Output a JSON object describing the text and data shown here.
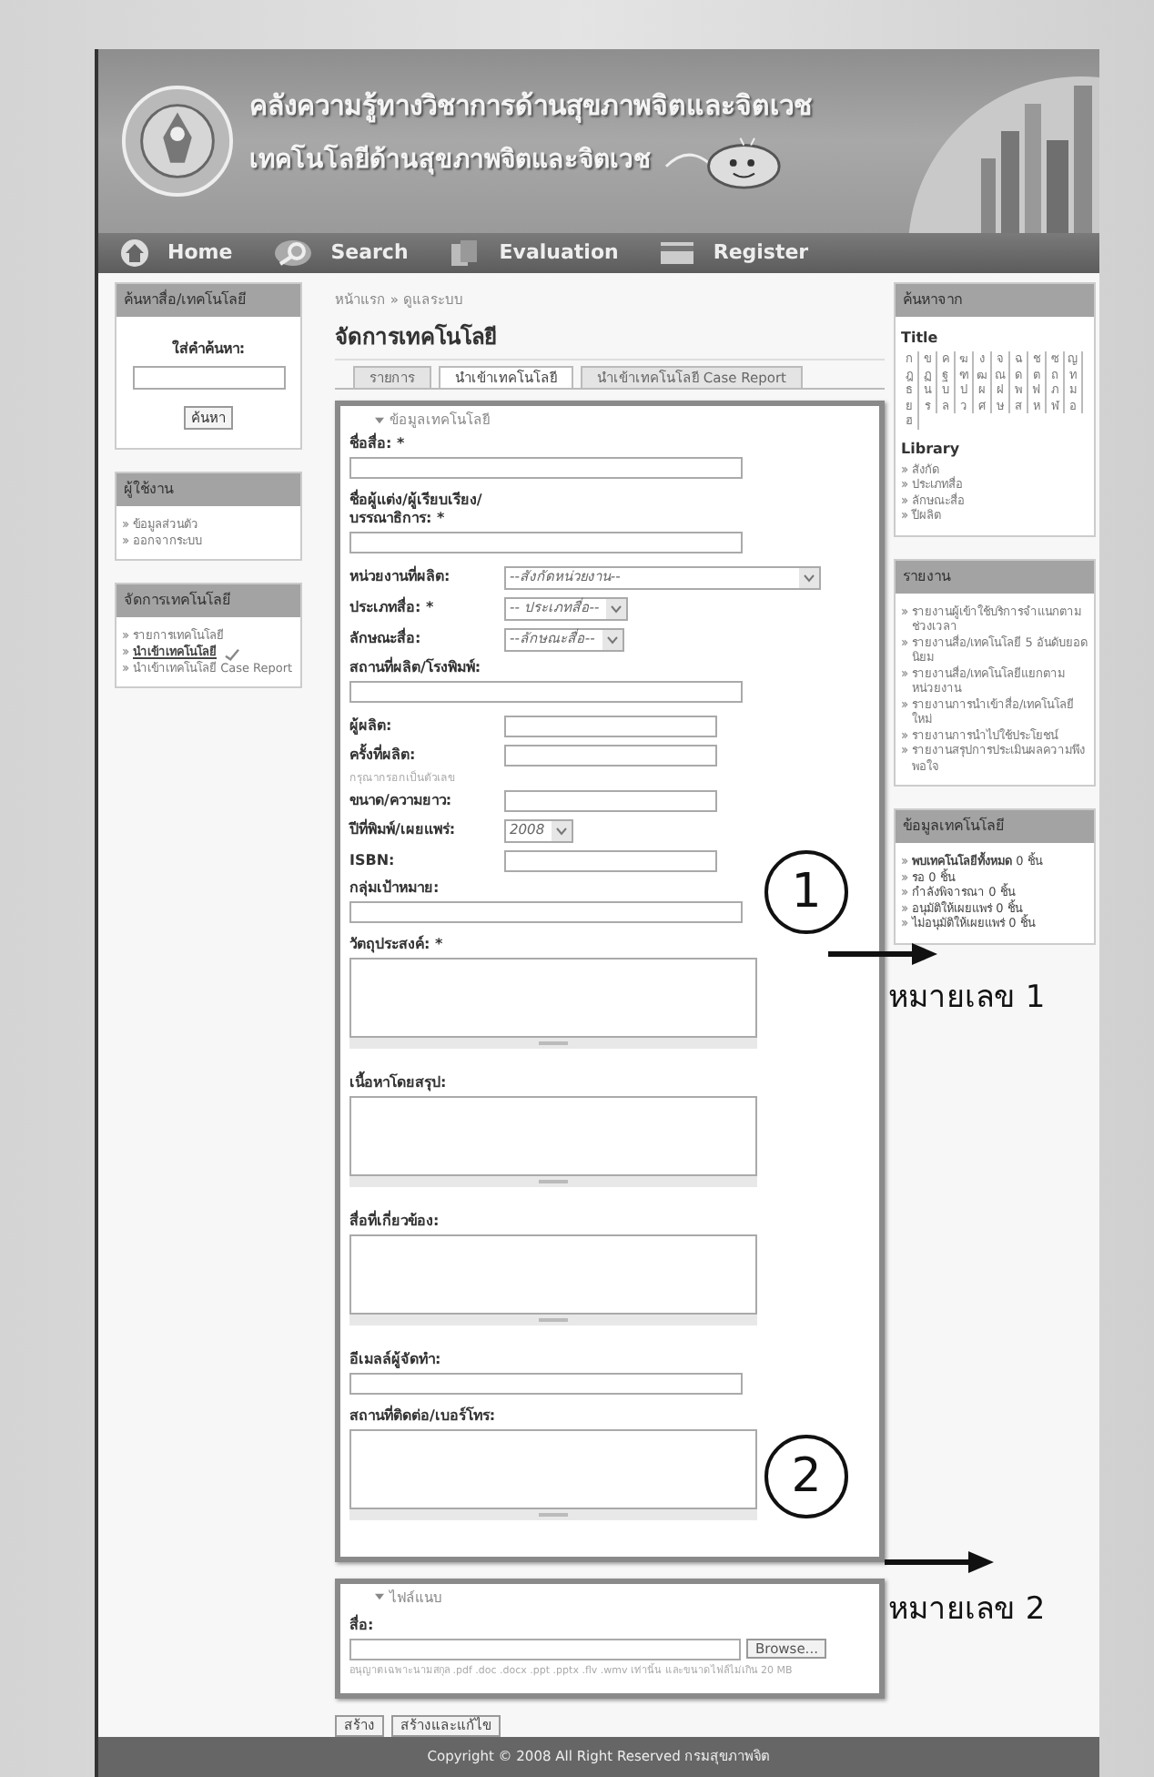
{
  "header": {
    "title": "คลังความรู้ทางวิชาการด้านสุขภาพจิตและจิตเวช",
    "subtitle": "เทคโนโลยีด้านสุขภาพจิตและจิตเวช"
  },
  "nav": [
    {
      "label": "Home",
      "kind": "home"
    },
    {
      "label": "Search",
      "kind": "search"
    },
    {
      "label": "Evaluation",
      "kind": "evaluation"
    },
    {
      "label": "Register",
      "kind": "register"
    }
  ],
  "search_panel": {
    "title": "ค้นหาสื่อ/เทคโนโลยี",
    "label": "ใส่คำค้นหา:",
    "button": "ค้นหา"
  },
  "user_panel": {
    "title": "ผู้ใช้งาน",
    "items": [
      "ข้อมูลส่วนตัว",
      "ออกจากระบบ"
    ]
  },
  "manage_panel": {
    "title": "จัดการเทคโนโลยี",
    "items": [
      {
        "label": "รายการเทคโนโลยี",
        "selected": false
      },
      {
        "label": "นำเข้าเทคโนโลยี",
        "selected": true
      },
      {
        "label": "นำเข้าเทคโนโลยี Case Report",
        "selected": false
      }
    ]
  },
  "breadcrumb": "หน้าแรก » ดูแลระบบ",
  "page_title": "จัดการเทคโนโลยี",
  "tabs": [
    {
      "label": "รายการ",
      "selected": false
    },
    {
      "label": "นำเข้าเทคโนโลยี",
      "selected": true
    },
    {
      "label": "นำเข้าเทคโนโลยี Case Report",
      "selected": false
    }
  ],
  "form": {
    "legend": "ข้อมูลเทคโนโลยี",
    "fields": [
      {
        "label": "ชื่อสื่อ: *",
        "kind": "text"
      },
      {
        "label": "ชื่อผู้แต่ง/ผู้เรียบเรียง/บรรณาธิการ: *",
        "kind": "text"
      },
      {
        "label": "หน่วยงานที่ผลิต:",
        "kind": "select_wide",
        "value": "--สังกัดหน่วยงาน--"
      },
      {
        "label": "ประเภทสื่อ: *",
        "kind": "select",
        "value": "-- ประเภทสื่อ--"
      },
      {
        "label": "ลักษณะสื่อ:",
        "kind": "select",
        "value": "--ลักษณะสื่อ--"
      },
      {
        "label": "สถานที่ผลิต/โรงพิมพ์:",
        "kind": "text"
      },
      {
        "label": "ผู้ผลิต:",
        "kind": "text_inline"
      },
      {
        "label": "ครั้งที่ผลิต:",
        "kind": "text_inline",
        "hint": "กรุณากรอกเป็นตัวเลข"
      },
      {
        "label": "ขนาด/ความยาว:",
        "kind": "text_inline"
      },
      {
        "label": "ปีที่พิมพ์/เผยแพร่:",
        "kind": "select",
        "value": "2008"
      },
      {
        "label": "ISBN:",
        "kind": "text_inline"
      },
      {
        "label": "กลุ่มเป้าหมาย:",
        "kind": "text"
      },
      {
        "label": "วัตถุประสงค์: *",
        "kind": "textarea"
      },
      {
        "label": "เนื้อหาโดยสรุป:",
        "kind": "textarea"
      },
      {
        "label": "สื่อที่เกี่ยวข้อง:",
        "kind": "textarea"
      },
      {
        "label": "อีเมลล์ผู้จัดทำ:",
        "kind": "text"
      },
      {
        "label": "สถานที่ติดต่อ/เบอร์โทร:",
        "kind": "textarea"
      }
    ]
  },
  "attachment": {
    "legend": "ไฟล์แนบ",
    "label": "สื่อ:",
    "browse_button": "Browse...",
    "hint": "อนุญาตเฉพาะนามสกุล .pdf .doc .docx .ppt .pptx .flv .wmv เท่านั้น และขนาดไฟล์ไม่เกิน 20 MB"
  },
  "buttons": [
    "สร้าง",
    "สร้างและแก้ไข"
  ],
  "footer": "Copyright © 2008 All Right Reserved กรมสุขภาพจิต",
  "browse_panel": {
    "title": "ค้นหาจาก",
    "title_heading": "Title",
    "letters": [
      "ก",
      "ข",
      "ค",
      "ฆ",
      "ง",
      "จ",
      "ฉ",
      "ช",
      "ซ",
      "ญ",
      "ฎ",
      "ฏ",
      "ฐ",
      "ฑ",
      "ฒ",
      "ณ",
      "ด",
      "ต",
      "ถ",
      "ท",
      "ธ",
      "น",
      "บ",
      "ป",
      "ผ",
      "ฝ",
      "พ",
      "ฟ",
      "ภ",
      "ม",
      "ย",
      "ร",
      "ล",
      "ว",
      "ศ",
      "ษ",
      "ส",
      "ห",
      "ฬ",
      "อ",
      "ฮ"
    ],
    "library_heading": "Library",
    "library_items": [
      "สังกัด",
      "ประเภทสื่อ",
      "ลักษณะสื่อ",
      "ปีผลิต"
    ]
  },
  "report_panel": {
    "title": "รายงาน",
    "items": [
      "รายงานผู้เข้าใช้บริการจำแนกตามช่วงเวลา",
      "รายงานสื่อ/เทคโนโลยี 5 อันดับยอดนิยม",
      "รายงานสื่อ/เทคโนโลยีแยกตามหน่วยงาน",
      "รายงานการนำเข้าสื่อ/เทคโนโลยีใหม่",
      "รายงานการนำไปใช้ประโยชน์",
      "รายงานสรุปการประเมินผลความพึงพอใจ"
    ]
  },
  "stats_panel": {
    "title": "ข้อมูลเทคโนโลยี",
    "items": [
      "**พบเทคโนโลยีทั้งหมด** 0 ชิ้น",
      "รอ 0 ชิ้น",
      "กำลังพิจารณา 0 ชิ้น",
      "อนุมัติให้เผยแพร่ 0 ชิ้น",
      "ไม่อนุมัติให้เผยแพร่ 0 ชิ้น"
    ]
  },
  "annotations": [
    {
      "number": "1",
      "label": "หมายเลข 1"
    },
    {
      "number": "2",
      "label": "หมายเลข 2"
    }
  ]
}
